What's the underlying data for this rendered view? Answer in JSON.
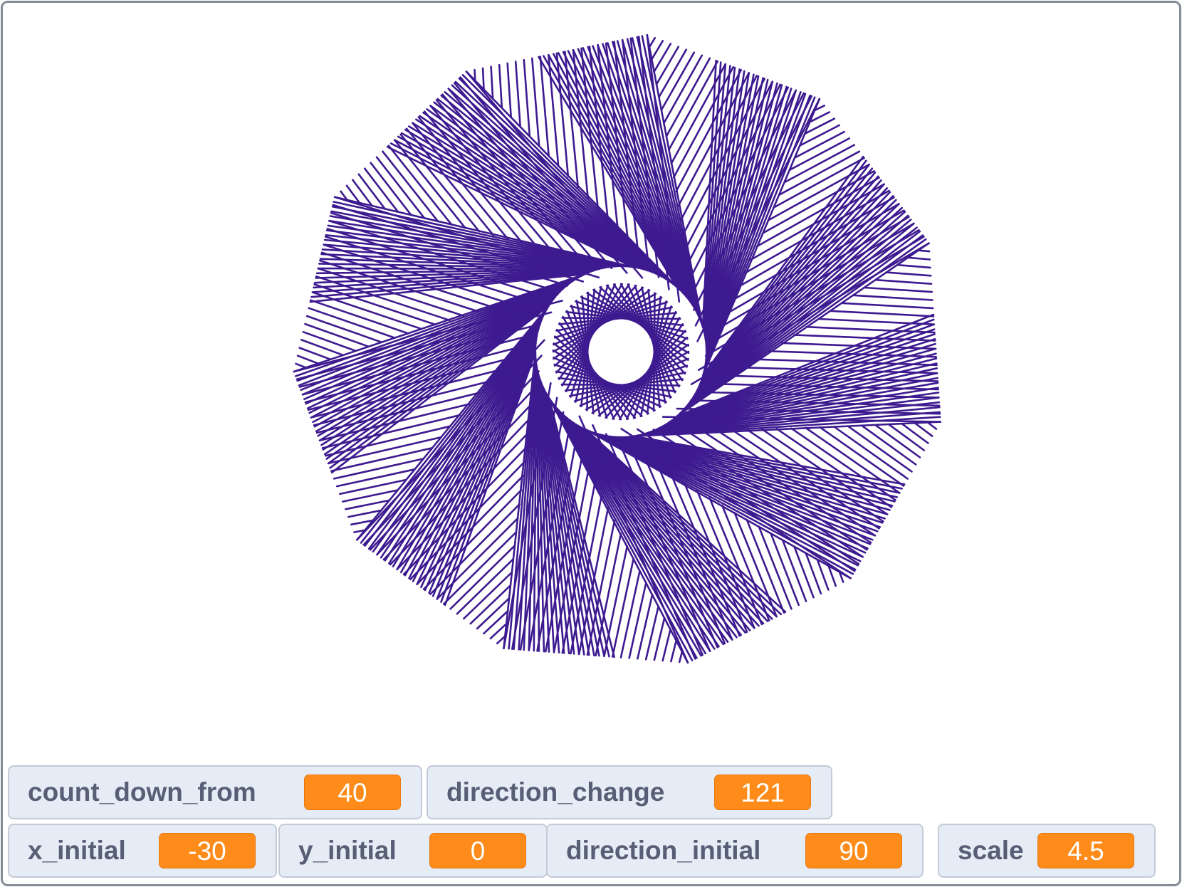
{
  "stage": {
    "pen_color": "#3d1a8f",
    "background": "#ffffff"
  },
  "pattern": {
    "initial_heading_deg": 90,
    "turn_deg": 121,
    "count_down_from": 40,
    "scale": 4.5
  },
  "monitors": {
    "count_down_from": {
      "label": "count_down_from",
      "value": "40"
    },
    "direction_change": {
      "label": "direction_change",
      "value": "121"
    },
    "x_initial": {
      "label": "x_initial",
      "value": "-30"
    },
    "y_initial": {
      "label": "y_initial",
      "value": "0"
    },
    "direction_initial": {
      "label": "direction_initial",
      "value": "90"
    },
    "scale": {
      "label": "scale",
      "value": "4.5"
    }
  },
  "colors": {
    "monitor_bg": "#e6ecf6",
    "monitor_border": "#c4cbd7",
    "label_text": "#575e75",
    "value_bg": "#ff8c1a",
    "value_text": "#ffffff",
    "stage_border": "#858b98"
  }
}
